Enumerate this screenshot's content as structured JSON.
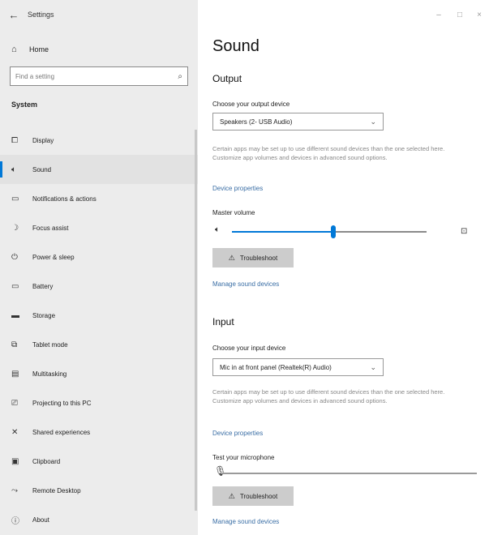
{
  "window": {
    "app_title": "Settings",
    "back_icon": "back-arrow-icon",
    "controls": {
      "minimize": "–",
      "maximize": "□",
      "close": "×"
    }
  },
  "sidebar": {
    "home_label": "Home",
    "search_placeholder": "Find a setting",
    "section_label": "System",
    "items": [
      {
        "label": "Display",
        "icon": "display-icon",
        "glyph": "⧠"
      },
      {
        "label": "Sound",
        "icon": "speaker-icon",
        "glyph": "🔈︎"
      },
      {
        "label": "Notifications & actions",
        "icon": "notifications-icon",
        "glyph": "▭"
      },
      {
        "label": "Focus assist",
        "icon": "moon-icon",
        "glyph": "☽"
      },
      {
        "label": "Power & sleep",
        "icon": "power-icon",
        "glyph": "⏻"
      },
      {
        "label": "Battery",
        "icon": "battery-icon",
        "glyph": "▭"
      },
      {
        "label": "Storage",
        "icon": "storage-icon",
        "glyph": "▬"
      },
      {
        "label": "Tablet mode",
        "icon": "tablet-icon",
        "glyph": "⧉"
      },
      {
        "label": "Multitasking",
        "icon": "multitasking-icon",
        "glyph": "▤"
      },
      {
        "label": "Projecting to this PC",
        "icon": "projecting-icon",
        "glyph": "⎚"
      },
      {
        "label": "Shared experiences",
        "icon": "shared-icon",
        "glyph": "✕"
      },
      {
        "label": "Clipboard",
        "icon": "clipboard-icon",
        "glyph": "▣"
      },
      {
        "label": "Remote Desktop",
        "icon": "remote-icon",
        "glyph": "⤳"
      },
      {
        "label": "About",
        "icon": "info-icon",
        "glyph": "ⓘ"
      }
    ],
    "active_index": 1
  },
  "main": {
    "title": "Sound",
    "output": {
      "heading": "Output",
      "choose_label": "Choose your output device",
      "device": "Speakers (2- USB Audio)",
      "description": "Certain apps may be set up to use different sound devices than the one selected here. Customize app volumes and devices in advanced sound options.",
      "properties_link": "Device properties",
      "volume_label": "Master volume",
      "volume": 0.52,
      "troubleshoot": "Troubleshoot",
      "manage_link": "Manage sound devices"
    },
    "input": {
      "heading": "Input",
      "choose_label": "Choose your input device",
      "device": "Mic in at front panel (Realtek(R) Audio)",
      "description": "Certain apps may be set up to use different sound devices than the one selected here. Customize app volumes and devices in advanced sound options.",
      "properties_link": "Device properties",
      "test_label": "Test your microphone",
      "troubleshoot": "Troubleshoot",
      "manage_link": "Manage sound devices"
    }
  },
  "colors": {
    "accent": "#0078d7",
    "sidebar_bg": "#ececec",
    "link": "#3a6ea5"
  }
}
